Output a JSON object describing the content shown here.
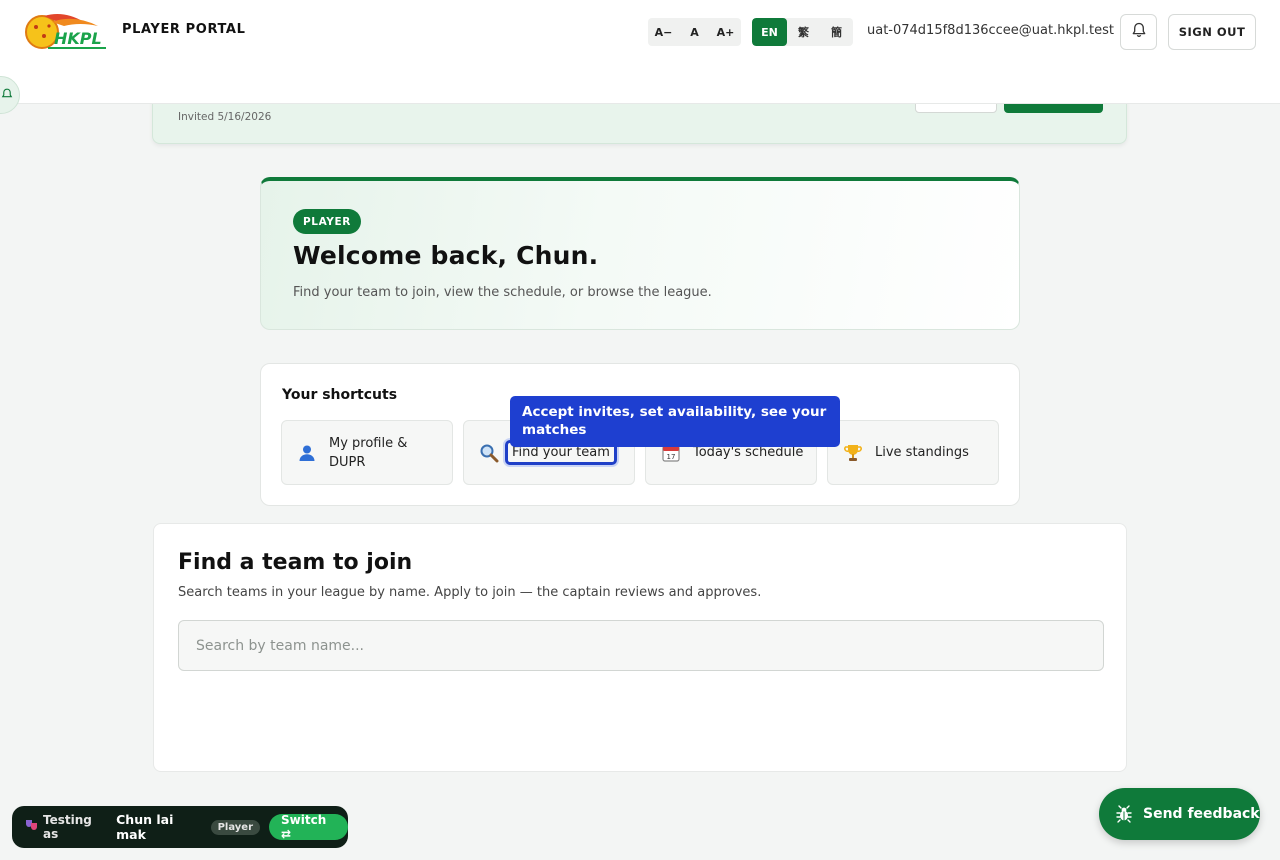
{
  "header": {
    "portal_title": "PLAYER PORTAL",
    "font_sizes": [
      "A−",
      "A",
      "A+"
    ],
    "languages": [
      "EN",
      "繁",
      "簡"
    ],
    "active_language": "EN",
    "user_email": "uat-074d15f8d136ccee@uat.hkpl.test",
    "sign_out_label": "SIGN OUT"
  },
  "invite": {
    "date_text": "Invited 5/16/2026"
  },
  "welcome": {
    "role_badge": "PLAYER",
    "title": "Welcome back, Chun.",
    "subtitle": "Find your team to join, view the schedule, or browse the league."
  },
  "shortcuts": {
    "title": "Your shortcuts",
    "items": [
      {
        "icon": "person-icon",
        "label": "My profile & DUPR"
      },
      {
        "icon": "magnifier-icon",
        "label": "Find your team"
      },
      {
        "icon": "calendar-icon",
        "label": "Today's schedule"
      },
      {
        "icon": "trophy-icon",
        "label": "Live standings"
      }
    ],
    "tooltip": "Accept invites, set availability, see your matches"
  },
  "find_team": {
    "title": "Find a team to join",
    "subtitle": "Search teams in your league by name. Apply to join — the captain reviews and approves.",
    "search_placeholder": "Search by team name..."
  },
  "testing_bar": {
    "label": "Testing as",
    "user_name": "Chun lai mak",
    "role": "Player",
    "switch_label": "Switch ⇄"
  },
  "feedback": {
    "label": "Send feedback"
  },
  "colors": {
    "brand_green": "#0f7a3a",
    "tooltip_blue": "#1e3fd0",
    "dark_bar": "#0f1f17"
  }
}
